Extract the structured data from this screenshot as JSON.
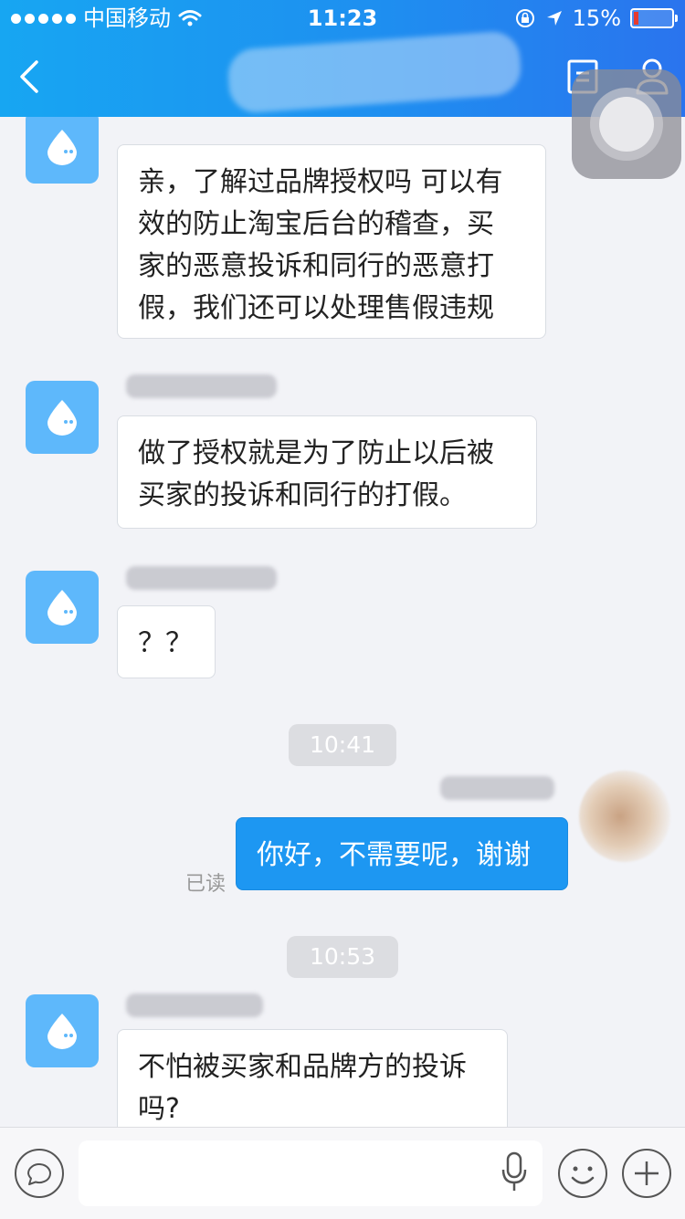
{
  "status_bar": {
    "carrier": "中国移动",
    "time": "11:23",
    "battery": "15%",
    "battery_level": 0.15
  },
  "messages": [
    {
      "from": "other",
      "text_lines": [
        "亲，了解过品牌授权吗 可以有",
        "效的防止淘宝后台的稽查，买",
        "家的恶意投诉和同行的恶意打",
        "假，我们还可以处理售假违规"
      ]
    },
    {
      "from": "other",
      "text_lines": [
        "做了授权就是为了防止以后被",
        "买家的投诉和同行的打假。"
      ]
    },
    {
      "from": "other",
      "text_lines": [
        "？？"
      ]
    },
    {
      "type": "time",
      "text": "10:41"
    },
    {
      "from": "me",
      "text_lines": [
        "你好，不需要呢，谢谢"
      ],
      "status": "已读"
    },
    {
      "type": "time",
      "text": "10:53"
    },
    {
      "from": "other",
      "text_lines": [
        "不怕被买家和品牌方的投诉",
        "吗?"
      ]
    }
  ],
  "icons": {
    "back": "chevron-left-icon",
    "doc": "document-icon",
    "user": "user-profile-icon",
    "chat": "chat-bubble-icon",
    "mic": "microphone-icon",
    "emoji": "emoji-icon",
    "plus": "plus-icon"
  },
  "colors": {
    "header": "#1e8ff0",
    "my_bubble": "#1d97f2",
    "avatar": "#5eb8fb",
    "background": "#f2f3f7"
  }
}
